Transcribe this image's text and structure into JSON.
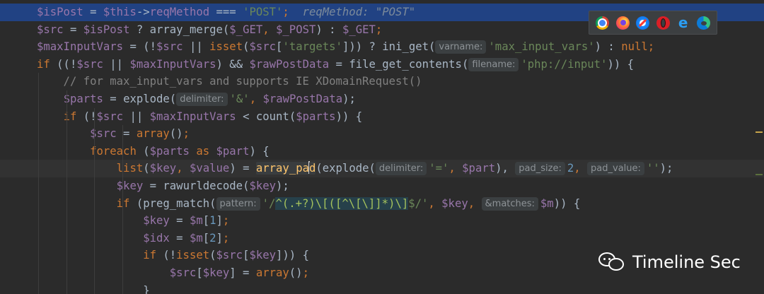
{
  "editor": {
    "lines": [
      {
        "segments": [
          {
            "t": "$isPost",
            "c": "var"
          },
          {
            "t": " = ",
            "c": "plain"
          },
          {
            "t": "$this",
            "c": "var"
          },
          {
            "t": "->",
            "c": "plain"
          },
          {
            "t": "reqMethod",
            "c": "var"
          },
          {
            "t": " === ",
            "c": "plain"
          },
          {
            "t": "'POST'",
            "c": "str"
          },
          {
            "t": ";",
            "c": "kw"
          },
          {
            "t": "  reqMethod: \"POST\"",
            "c": "hint-inline"
          }
        ]
      },
      {
        "segments": [
          {
            "t": "$src",
            "c": "var"
          },
          {
            "t": " = ",
            "c": "plain"
          },
          {
            "t": "$isPost",
            "c": "var"
          },
          {
            "t": " ? ",
            "c": "plain"
          },
          {
            "t": "array_merge",
            "c": "plain"
          },
          {
            "t": "(",
            "c": "plain"
          },
          {
            "t": "$_GET",
            "c": "var"
          },
          {
            "t": ", ",
            "c": "kw"
          },
          {
            "t": "$_POST",
            "c": "var"
          },
          {
            "t": ") : ",
            "c": "plain"
          },
          {
            "t": "$_GET",
            "c": "var"
          },
          {
            "t": ";",
            "c": "kw"
          }
        ]
      },
      {
        "segments": [
          {
            "t": "$maxInputVars",
            "c": "var"
          },
          {
            "t": " = (!",
            "c": "plain"
          },
          {
            "t": "$src",
            "c": "var"
          },
          {
            "t": " || ",
            "c": "plain"
          },
          {
            "t": "isset",
            "c": "kw"
          },
          {
            "t": "(",
            "c": "plain"
          },
          {
            "t": "$src",
            "c": "var"
          },
          {
            "t": "[",
            "c": "plain"
          },
          {
            "t": "'targets'",
            "c": "str"
          },
          {
            "t": "])) ? ",
            "c": "plain"
          },
          {
            "t": "ini_get",
            "c": "plain"
          },
          {
            "t": "(",
            "c": "plain"
          },
          {
            "t": "varname:",
            "c": "hint"
          },
          {
            "t": "'max_input_vars'",
            "c": "str"
          },
          {
            "t": ") : ",
            "c": "plain"
          },
          {
            "t": "null",
            "c": "kw"
          },
          {
            "t": ";",
            "c": "kw"
          }
        ]
      },
      {
        "segments": [
          {
            "t": "if",
            "c": "kw"
          },
          {
            "t": " ((!",
            "c": "plain"
          },
          {
            "t": "$src",
            "c": "var"
          },
          {
            "t": " || ",
            "c": "plain"
          },
          {
            "t": "$maxInputVars",
            "c": "var"
          },
          {
            "t": ") && ",
            "c": "plain"
          },
          {
            "t": "$rawPostData",
            "c": "var"
          },
          {
            "t": " = ",
            "c": "plain"
          },
          {
            "t": "file_get_contents",
            "c": "plain"
          },
          {
            "t": "(",
            "c": "plain"
          },
          {
            "t": "filename:",
            "c": "hint"
          },
          {
            "t": "'php://input'",
            "c": "str"
          },
          {
            "t": ")) {",
            "c": "plain"
          }
        ]
      },
      {
        "segments": [
          {
            "t": "    // for max_input_vars and supports IE XDomainRequest()",
            "c": "cmt"
          }
        ]
      },
      {
        "segments": [
          {
            "t": "    ",
            "c": "plain"
          },
          {
            "t": "$parts",
            "c": "var"
          },
          {
            "t": " = ",
            "c": "plain"
          },
          {
            "t": "explode",
            "c": "plain"
          },
          {
            "t": "(",
            "c": "plain"
          },
          {
            "t": "delimiter:",
            "c": "hint"
          },
          {
            "t": "'&'",
            "c": "str"
          },
          {
            "t": ", ",
            "c": "kw"
          },
          {
            "t": "$rawPostData",
            "c": "var"
          },
          {
            "t": ");",
            "c": "plain"
          }
        ]
      },
      {
        "segments": [
          {
            "t": "    ",
            "c": "plain"
          },
          {
            "t": "if",
            "c": "kw"
          },
          {
            "t": " (!",
            "c": "plain"
          },
          {
            "t": "$src",
            "c": "var"
          },
          {
            "t": " || ",
            "c": "plain"
          },
          {
            "t": "$maxInputVars",
            "c": "var"
          },
          {
            "t": " < ",
            "c": "plain"
          },
          {
            "t": "count",
            "c": "plain"
          },
          {
            "t": "(",
            "c": "plain"
          },
          {
            "t": "$parts",
            "c": "var"
          },
          {
            "t": ")) {",
            "c": "plain"
          }
        ]
      },
      {
        "segments": [
          {
            "t": "        ",
            "c": "plain"
          },
          {
            "t": "$src",
            "c": "var"
          },
          {
            "t": " = ",
            "c": "plain"
          },
          {
            "t": "array",
            "c": "kw"
          },
          {
            "t": "()",
            "c": "plain"
          },
          {
            "t": ";",
            "c": "kw"
          }
        ]
      },
      {
        "segments": [
          {
            "t": "        ",
            "c": "plain"
          },
          {
            "t": "foreach",
            "c": "kw"
          },
          {
            "t": " (",
            "c": "plain"
          },
          {
            "t": "$parts",
            "c": "var"
          },
          {
            "t": " as ",
            "c": "kw"
          },
          {
            "t": "$part",
            "c": "var"
          },
          {
            "t": ") {",
            "c": "plain"
          }
        ]
      },
      {
        "segments": [
          {
            "t": "            ",
            "c": "plain"
          },
          {
            "t": "list",
            "c": "kw"
          },
          {
            "t": "(",
            "c": "plain"
          },
          {
            "t": "$key",
            "c": "var"
          },
          {
            "t": ", ",
            "c": "kw"
          },
          {
            "t": "$value",
            "c": "var"
          },
          {
            "t": ") = ",
            "c": "plain"
          },
          {
            "t": "array_pa",
            "c": "word"
          },
          {
            "t": "|",
            "c": "caret"
          },
          {
            "t": "d",
            "c": "word"
          },
          {
            "t": "(",
            "c": "plain"
          },
          {
            "t": "explode",
            "c": "plain"
          },
          {
            "t": "(",
            "c": "plain"
          },
          {
            "t": "delimiter:",
            "c": "hint"
          },
          {
            "t": "'='",
            "c": "str"
          },
          {
            "t": ", ",
            "c": "kw"
          },
          {
            "t": "$part",
            "c": "var"
          },
          {
            "t": "), ",
            "c": "plain"
          },
          {
            "t": "pad_size:",
            "c": "hint"
          },
          {
            "t": "2",
            "c": "num"
          },
          {
            "t": ", ",
            "c": "kw"
          },
          {
            "t": "pad_value:",
            "c": "hint"
          },
          {
            "t": "''",
            "c": "str"
          },
          {
            "t": ");",
            "c": "plain"
          }
        ]
      },
      {
        "segments": [
          {
            "t": "            ",
            "c": "plain"
          },
          {
            "t": "$key",
            "c": "var"
          },
          {
            "t": " = ",
            "c": "plain"
          },
          {
            "t": "rawurldecode",
            "c": "plain"
          },
          {
            "t": "(",
            "c": "plain"
          },
          {
            "t": "$key",
            "c": "var"
          },
          {
            "t": ");",
            "c": "plain"
          }
        ]
      },
      {
        "segments": [
          {
            "t": "            ",
            "c": "plain"
          },
          {
            "t": "if",
            "c": "kw"
          },
          {
            "t": " (",
            "c": "plain"
          },
          {
            "t": "preg_match",
            "c": "plain"
          },
          {
            "t": "(",
            "c": "plain"
          },
          {
            "t": "pattern:",
            "c": "hint"
          },
          {
            "t": "'/",
            "c": "str"
          },
          {
            "t": "^(.+?)\\[([^\\[\\]]*)\\]",
            "c": "rx"
          },
          {
            "t": "$/'",
            "c": "str"
          },
          {
            "t": ", ",
            "c": "kw"
          },
          {
            "t": "$key",
            "c": "var"
          },
          {
            "t": ", ",
            "c": "kw"
          },
          {
            "t": "&matches:",
            "c": "hint"
          },
          {
            "t": "$m",
            "c": "var"
          },
          {
            "t": ")) {",
            "c": "plain"
          }
        ]
      },
      {
        "segments": [
          {
            "t": "                ",
            "c": "plain"
          },
          {
            "t": "$key",
            "c": "var"
          },
          {
            "t": " = ",
            "c": "plain"
          },
          {
            "t": "$m",
            "c": "var"
          },
          {
            "t": "[",
            "c": "plain"
          },
          {
            "t": "1",
            "c": "num"
          },
          {
            "t": "]",
            "c": "plain"
          },
          {
            "t": ";",
            "c": "kw"
          }
        ]
      },
      {
        "segments": [
          {
            "t": "                ",
            "c": "plain"
          },
          {
            "t": "$idx",
            "c": "var"
          },
          {
            "t": " = ",
            "c": "plain"
          },
          {
            "t": "$m",
            "c": "var"
          },
          {
            "t": "[",
            "c": "plain"
          },
          {
            "t": "2",
            "c": "num"
          },
          {
            "t": "]",
            "c": "plain"
          },
          {
            "t": ";",
            "c": "kw"
          }
        ]
      },
      {
        "segments": [
          {
            "t": "                ",
            "c": "plain"
          },
          {
            "t": "if",
            "c": "kw"
          },
          {
            "t": " (!",
            "c": "plain"
          },
          {
            "t": "isset",
            "c": "kw"
          },
          {
            "t": "(",
            "c": "plain"
          },
          {
            "t": "$src",
            "c": "var"
          },
          {
            "t": "[",
            "c": "plain"
          },
          {
            "t": "$key",
            "c": "var"
          },
          {
            "t": "])) {",
            "c": "plain"
          }
        ]
      },
      {
        "segments": [
          {
            "t": "                    ",
            "c": "plain"
          },
          {
            "t": "$src",
            "c": "var"
          },
          {
            "t": "[",
            "c": "plain"
          },
          {
            "t": "$key",
            "c": "var"
          },
          {
            "t": "] = ",
            "c": "plain"
          },
          {
            "t": "array",
            "c": "kw"
          },
          {
            "t": "()",
            "c": "plain"
          },
          {
            "t": ";",
            "c": "kw"
          }
        ]
      },
      {
        "segments": [
          {
            "t": "                }",
            "c": "plain"
          }
        ]
      }
    ]
  },
  "browser_icons": [
    "chrome-icon",
    "firefox-icon",
    "safari-icon",
    "opera-icon",
    "ie-icon",
    "edge-icon"
  ],
  "ie_glyph": "e",
  "watermark": {
    "text": "Timeline Sec"
  },
  "colors": {
    "background": "#2b2b2b",
    "selection": "#214283",
    "variable": "#9876aa",
    "keyword": "#cc7832",
    "string": "#6a8759",
    "comment": "#808080",
    "number": "#6897bb"
  }
}
